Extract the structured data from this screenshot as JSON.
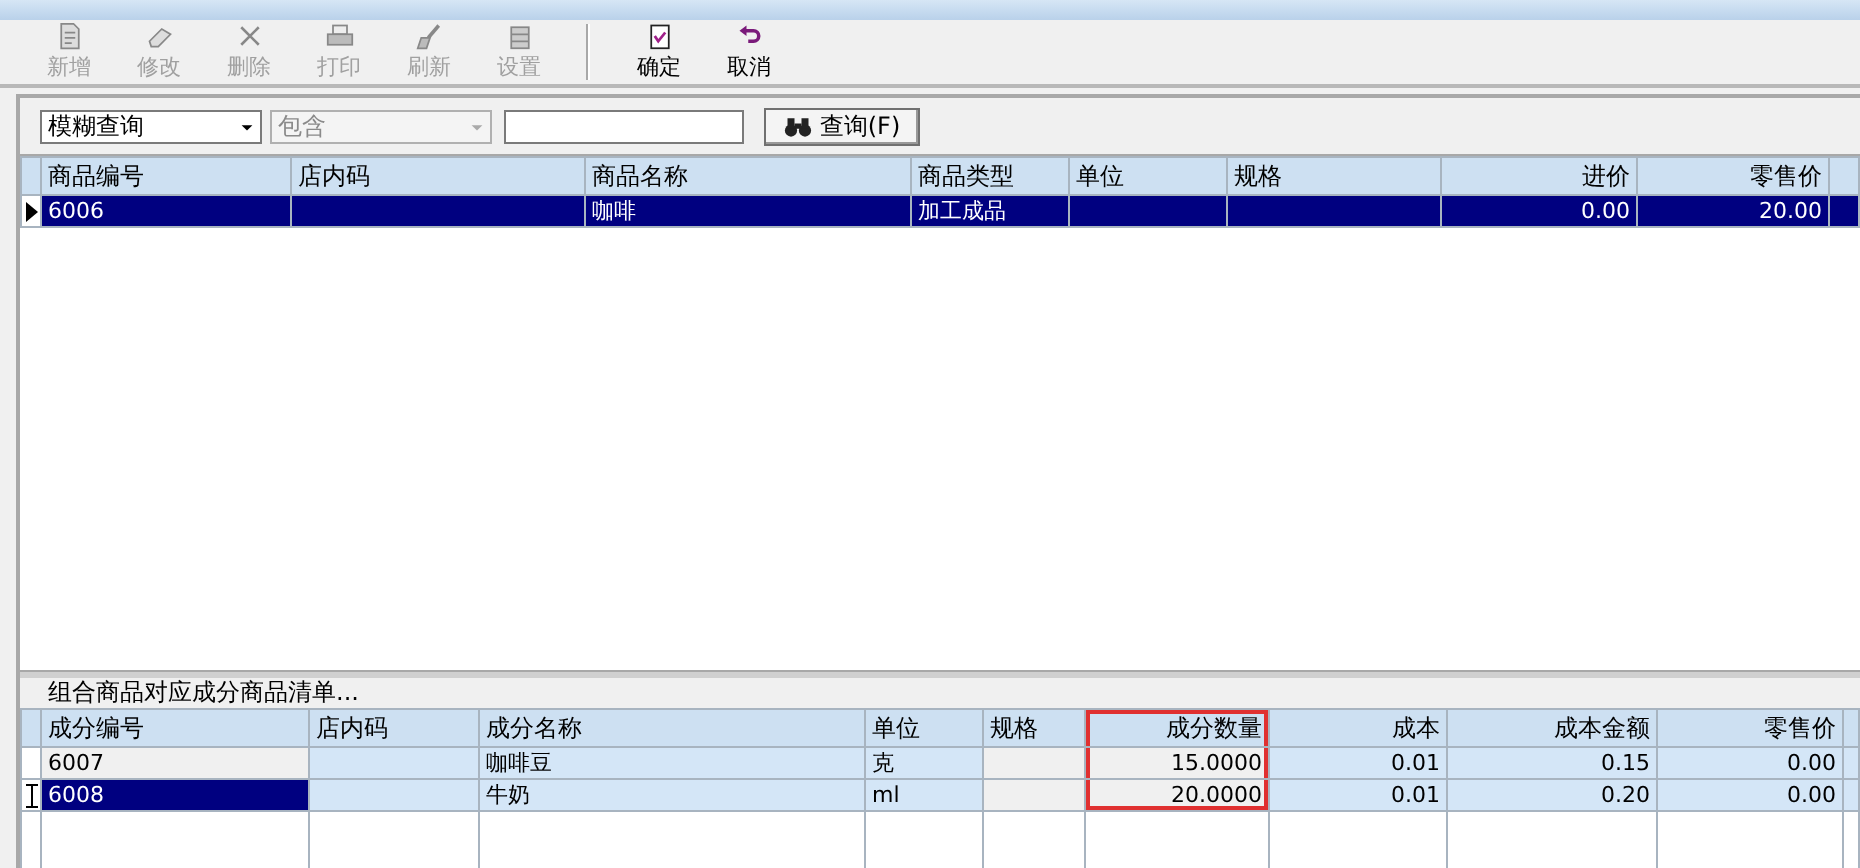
{
  "toolbar": [
    {
      "kind": "new",
      "label": "新增",
      "disabled": true
    },
    {
      "kind": "edit",
      "label": "修改",
      "disabled": true
    },
    {
      "kind": "delete",
      "label": "删除",
      "disabled": true
    },
    {
      "kind": "print",
      "label": "打印",
      "disabled": true
    },
    {
      "kind": "refresh",
      "label": "刷新",
      "disabled": true
    },
    {
      "kind": "settings",
      "label": "设置",
      "disabled": true
    },
    {
      "kind": "separator"
    },
    {
      "kind": "confirm",
      "label": "确定",
      "disabled": false
    },
    {
      "kind": "cancel",
      "label": "取消",
      "disabled": false
    }
  ],
  "filter": {
    "mode": "模糊查询",
    "match": "包含",
    "match_disabled": true,
    "search_button": "查询(F)"
  },
  "products": {
    "columns": [
      "商品编号",
      "店内码",
      "商品名称",
      "商品类型",
      "单位",
      "规格",
      "进价",
      "零售价"
    ],
    "rows": [
      {
        "selected": true,
        "cells": [
          "6006",
          null,
          "咖啡",
          "加工成品",
          null,
          null,
          "0.00",
          "20.00"
        ]
      }
    ]
  },
  "components": {
    "caption": "组合商品对应成分商品清单...",
    "columns": [
      {
        "label": "成分编号",
        "highlighted": false
      },
      {
        "label": "店内码",
        "highlighted": false
      },
      {
        "label": "成分名称",
        "highlighted": false
      },
      {
        "label": "单位",
        "highlighted": false
      },
      {
        "label": "规格",
        "highlighted": false
      },
      {
        "label": "成分数量",
        "highlighted": true
      },
      {
        "label": "成本",
        "highlighted": false
      },
      {
        "label": "成本金额",
        "highlighted": false
      },
      {
        "label": "零售价",
        "highlighted": false
      }
    ],
    "rows": [
      {
        "current": false,
        "cells": [
          "6007",
          null,
          "咖啡豆",
          "克",
          null,
          "15.0000",
          "0.01",
          "0.15",
          "0.00"
        ]
      },
      {
        "current": true,
        "cells": [
          "6008",
          null,
          "牛奶",
          "ml",
          null,
          "20.0000",
          "0.01",
          "0.20",
          "0.00"
        ]
      }
    ]
  }
}
